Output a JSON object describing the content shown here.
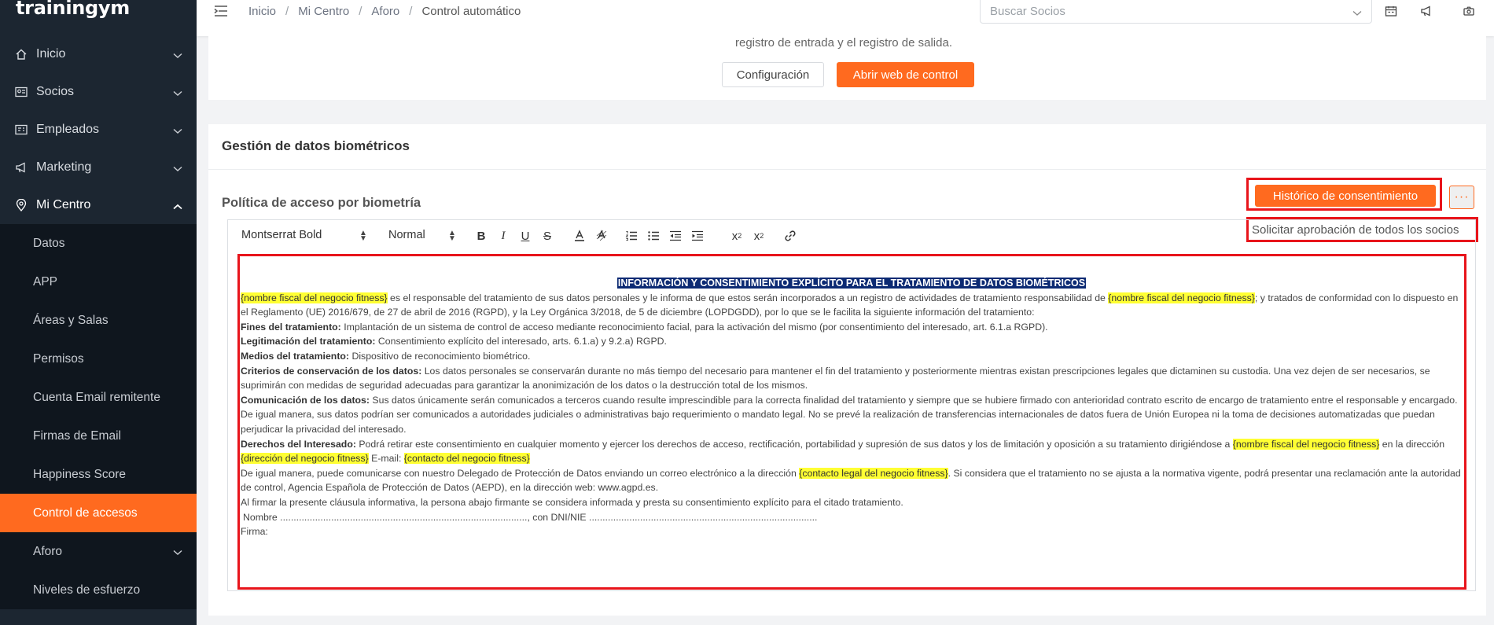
{
  "app": {
    "logo": "trainingym"
  },
  "sidebar": {
    "items": [
      {
        "label": "Inicio",
        "icon": "home-icon"
      },
      {
        "label": "Socios",
        "icon": "id-card-icon"
      },
      {
        "label": "Empleados",
        "icon": "badge-icon"
      },
      {
        "label": "Marketing",
        "icon": "megaphone-icon"
      },
      {
        "label": "Mi Centro",
        "icon": "location-pin-icon"
      }
    ],
    "submenu": [
      {
        "label": "Datos"
      },
      {
        "label": "APP"
      },
      {
        "label": "Áreas y Salas"
      },
      {
        "label": "Permisos"
      },
      {
        "label": "Cuenta Email remitente"
      },
      {
        "label": "Firmas de Email"
      },
      {
        "label": "Happiness Score"
      },
      {
        "label": "Control de accesos"
      },
      {
        "label": "Aforo"
      },
      {
        "label": "Niveles de esfuerzo"
      }
    ],
    "active_submenu": "Control de accesos",
    "accent_color": "#ff6a1f"
  },
  "topbar": {
    "breadcrumb": [
      "Inicio",
      "Mi Centro",
      "Aforo",
      "Control automático"
    ],
    "search_placeholder": "Buscar Socios"
  },
  "control_card": {
    "description": "registro de entrada y el registro de salida.",
    "config_button": "Configuración",
    "open_web_button": "Abrir web de control"
  },
  "biometric_card": {
    "title": "Gestión de datos biométricos",
    "policy_title": "Política de acceso por biometría",
    "history_button": "Histórico de consentimiento",
    "more_button": "···",
    "dropdown_item": "Solicitar aprobación de todos los socios",
    "toolbar": {
      "font": "Montserrat Bold",
      "size": "Normal",
      "sub": "x",
      "sub_mark": "2",
      "sup": "x",
      "sup_mark": "2"
    },
    "document": {
      "heading": "INFORMACIÓN Y CONSENTIMIENTO EXPLÍCITO PARA EL TRATAMIENTO DE DATOS BIOMÉTRICOS",
      "p1_hl1": "{nombre fiscal del negocio fitness}",
      "p1_t1": " es el responsable del tratamiento de sus datos personales y le informa de que estos serán incorporados a un registro de actividades de tratamiento responsabilidad de ",
      "p1_hl2": "{nombre fiscal del negocio fitness}",
      "p1_t2": "; y tratados de conformidad con lo dispuesto en el Reglamento (UE) 2016/679, de 27 de abril de 2016 (RGPD), y la Ley Orgánica 3/2018, de 5 de diciembre (LOPDGDD), por lo que se le facilita la siguiente información del tratamiento:",
      "fines_label": "Fines del tratamiento:",
      "fines_text": " Implantación de un sistema de control de acceso mediante reconocimiento facial, para la activación del mismo (por consentimiento del interesado, art. 6.1.a RGPD).",
      "leg_label": "Legitimación del tratamiento:",
      "leg_text": " Consentimiento explícito del interesado, arts. 6.1.a) y 9.2.a) RGPD.",
      "medios_label": "Medios del tratamiento:",
      "medios_text": " Dispositivo de reconocimiento biométrico.",
      "crit_label": "Criterios de conservación de los datos:",
      "crit_text": " Los datos personales se conservarán durante no más tiempo del necesario para mantener el fin del tratamiento y posteriormente mientras existan prescripciones legales que dictaminen su custodia. Una vez dejen de ser necesarios, se suprimirán con medidas de seguridad adecuadas para garantizar la anonimización de los datos o la destrucción total de los mismos.",
      "com_label": "Comunicación de los datos:",
      "com_text": " Sus datos únicamente serán comunicados a terceros cuando resulte imprescindible para la correcta finalidad del tratamiento y siempre que se hubiere firmado con anterioridad contrato escrito de encargo de tratamiento entre el responsable y encargado. De igual manera, sus datos podrían ser comunicados a autoridades judiciales o administrativas bajo requerimiento o mandato legal. No se prevé la realización de transferencias internacionales de datos fuera de Unión Europea ni la toma de decisiones automatizadas que puedan perjudicar la privacidad del interesado.",
      "der_label": "Derechos del Interesado:",
      "der_text": " Podrá retirar este consentimiento en cualquier momento y ejercer los derechos de acceso, rectificación, portabilidad y supresión de sus datos y los de limitación y oposición a su tratamiento dirigiéndose a ",
      "der_hl1": "{nombre fiscal del negocio fitness}",
      "der_t2": " en la dirección ",
      "der_hl2": "{dirección del negocio fitness}",
      "der_t3": " E-mail: ",
      "der_hl3": "{contacto del negocio fitness}",
      "dpo_t1": "De igual manera, puede comunicarse con nuestro Delegado de Protección de Datos enviando un correo electrónico a la dirección ",
      "dpo_hl": "{contacto legal del negocio fitness}",
      "dpo_t2": ". Si considera que el tratamiento no se ajusta a la normativa vigente, podrá presentar una reclamación ante la autoridad de control, Agencia Española de Protección de Datos (AEPD), en la dirección web: www.agpd.es.",
      "final_text": "Al firmar la presente cláusula informativa, la persona abajo firmante se considera informada y presta su consentimiento explícito para el citado tratamiento.",
      "sign_line": "Nombre ............................................................................................, con DNI/NIE .....................................................................................",
      "firma": "Firma:"
    }
  }
}
